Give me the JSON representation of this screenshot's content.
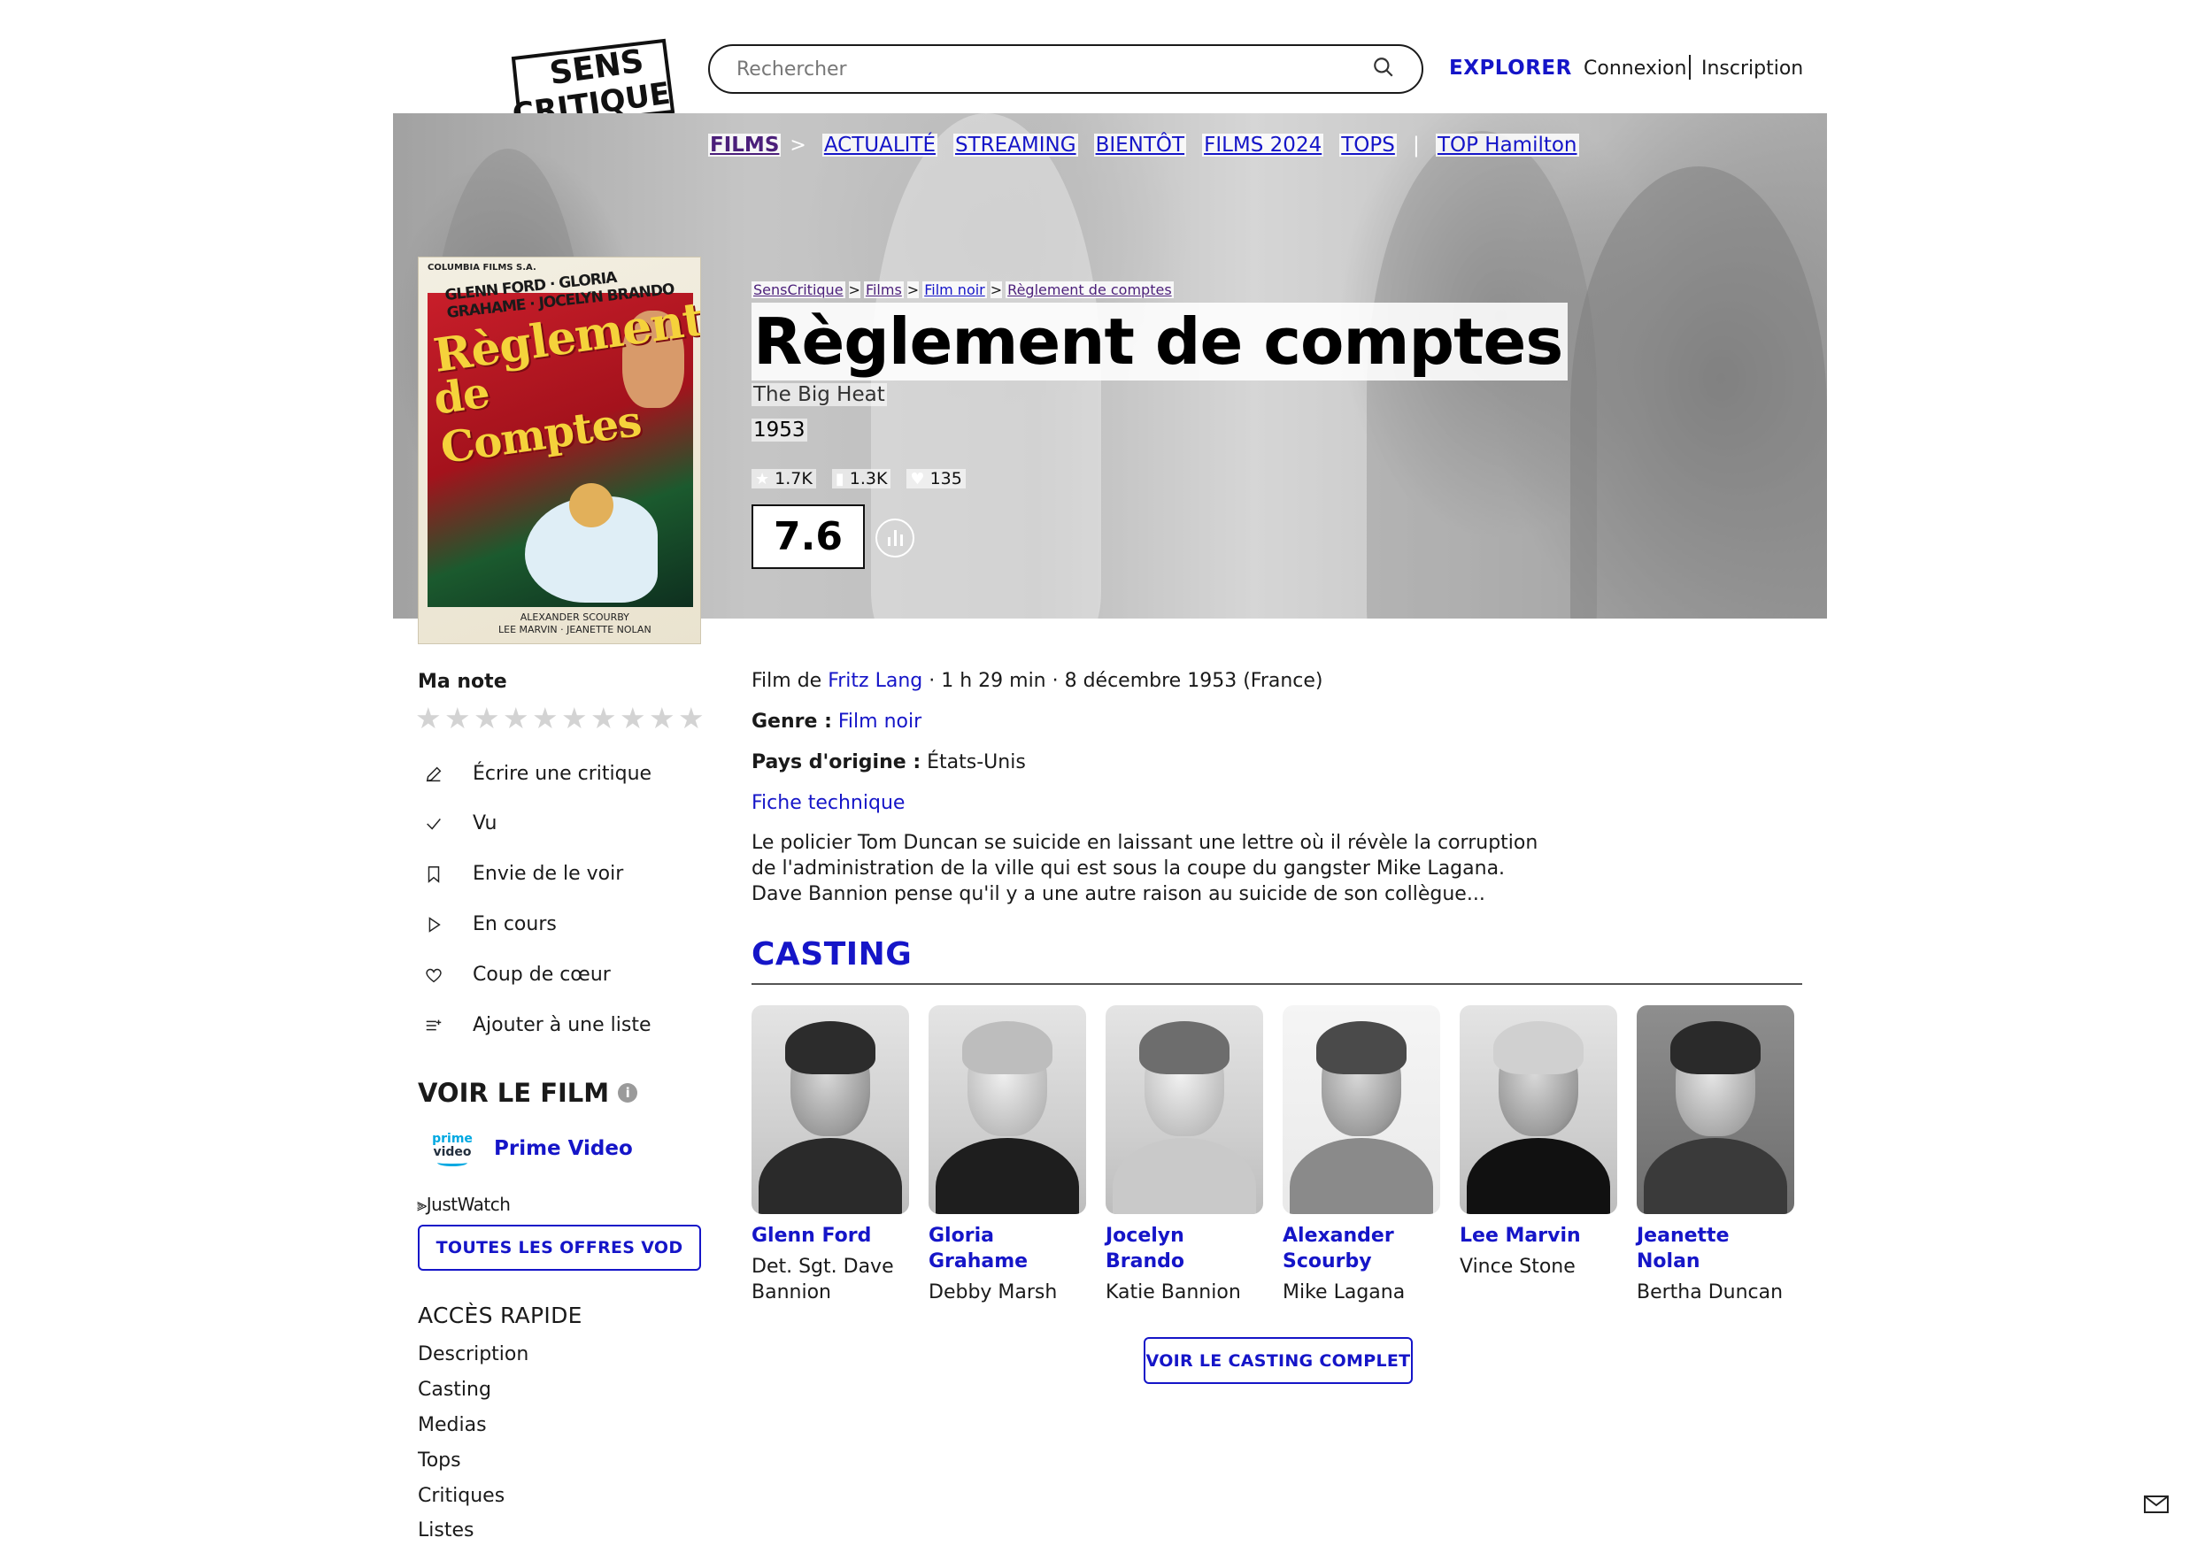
{
  "header": {
    "logo_line1": "SENS",
    "logo_line2": "CRITIQUE",
    "search_placeholder": "Rechercher",
    "explore": "EXPLORER",
    "connexion": "Connexion",
    "inscription": "Inscription"
  },
  "subnav": {
    "films": "FILMS",
    "chevron": ">",
    "items": [
      "ACTUALITÉ",
      "STREAMING",
      "BIENTÔT",
      "FILMS 2024",
      "TOPS"
    ],
    "separator": "|",
    "top": "TOP Hamilton"
  },
  "poster": {
    "studio": "COLUMBIA FILMS S.A.",
    "names": "GLENN FORD · GLORIA GRAHAME · JOCELYN BRANDO",
    "title_line1": "Règlement",
    "title_line2": "de Comptes",
    "credits_line1": "ALEXANDER SCOURBY",
    "credits_line2": "LEE MARVIN · JEANETTE NOLAN"
  },
  "breadcrumb": [
    "SensCritique",
    "Films",
    "Film noir",
    "Règlement de comptes"
  ],
  "breadcrumb_sep": ">",
  "movie": {
    "title": "Règlement de comptes",
    "original_title": "The Big Heat",
    "year": "1953",
    "stats": {
      "ratings": "1.7K",
      "wishlist": "1.3K",
      "favorites": "135"
    },
    "score": "7.6"
  },
  "user": {
    "my_rating_label": "Ma note",
    "stars": 10,
    "star_glyph": "★",
    "actions": [
      {
        "label": "Écrire une critique",
        "icon": "pencil-icon"
      },
      {
        "label": "Vu",
        "icon": "check-icon"
      },
      {
        "label": "Envie de le voir",
        "icon": "bookmark-icon"
      },
      {
        "label": "En cours",
        "icon": "play-icon"
      },
      {
        "label": "Coup de cœur",
        "icon": "heart-icon"
      },
      {
        "label": "Ajouter à une liste",
        "icon": "list-add-icon"
      }
    ]
  },
  "watch": {
    "title": "VOIR LE FILM",
    "info": "i",
    "provider_logo_line1": "prime",
    "provider_logo_line2": "video",
    "provider": "Prime Video",
    "justwatch": "JustWatch",
    "vod_button": "TOUTES LES OFFRES VOD"
  },
  "quick_access": {
    "title": "ACCÈS RAPIDE",
    "items": [
      "Description",
      "Casting",
      "Medias",
      "Tops",
      "Critiques",
      "Listes"
    ]
  },
  "details": {
    "film_de": "Film de",
    "director": "Fritz Lang",
    "meta": "· 1 h 29 min · 8 décembre 1953 (France)",
    "genre_label": "Genre :",
    "genre": "Film noir",
    "pays_label": "Pays d'origine :",
    "pays": "États-Unis",
    "fiche": "Fiche technique",
    "synopsis": "Le policier Tom Duncan se suicide en laissant une lettre où il révèle la corruption de l'administration de la ville qui est sous la coupe du gangster Mike Lagana. Dave Bannion pense qu'il y a une autre raison au suicide de son collègue..."
  },
  "casting": {
    "title": "CASTING",
    "members": [
      {
        "name": "Glenn Ford",
        "role": "Det. Sgt. Dave Bannion"
      },
      {
        "name": "Gloria Grahame",
        "role": "Debby Marsh"
      },
      {
        "name": "Jocelyn Brando",
        "role": "Katie Bannion"
      },
      {
        "name": "Alexander Scourby",
        "role": "Mike Lagana"
      },
      {
        "name": "Lee Marvin",
        "role": "Vince Stone"
      },
      {
        "name": "Jeanette Nolan",
        "role": "Bertha Duncan"
      }
    ],
    "button": "VOIR LE CASTING COMPLET"
  },
  "colors": {
    "accent": "#1515c8",
    "visited": "#4b1f7a",
    "text": "#1a1a1a"
  }
}
